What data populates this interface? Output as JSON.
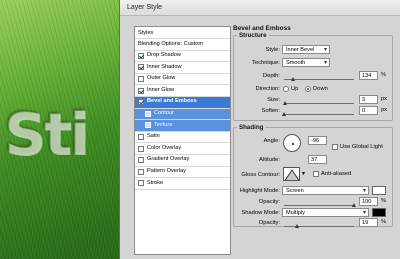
{
  "window": {
    "title": "Layer Style"
  },
  "sidebar": {
    "header": "Styles",
    "items": [
      {
        "label": "Blending Options: Custom",
        "checkbox": false,
        "checked": false
      },
      {
        "label": "Drop Shadow",
        "checkbox": true,
        "checked": true
      },
      {
        "label": "Inner Shadow",
        "checkbox": true,
        "checked": true
      },
      {
        "label": "Outer Glow",
        "checkbox": true,
        "checked": false
      },
      {
        "label": "Inner Glow",
        "checkbox": true,
        "checked": true
      },
      {
        "label": "Bevel and Emboss",
        "checkbox": true,
        "checked": true,
        "selected": true
      },
      {
        "label": "Contour",
        "checkbox": true,
        "checked": false,
        "sub": true
      },
      {
        "label": "Texture",
        "checkbox": true,
        "checked": false,
        "sub": true
      },
      {
        "label": "Satin",
        "checkbox": true,
        "checked": false
      },
      {
        "label": "Color Overlay",
        "checkbox": true,
        "checked": false
      },
      {
        "label": "Gradient Overlay",
        "checkbox": true,
        "checked": false
      },
      {
        "label": "Pattern Overlay",
        "checkbox": true,
        "checked": false
      },
      {
        "label": "Stroke",
        "checkbox": true,
        "checked": false
      }
    ]
  },
  "panel": {
    "title": "Bevel and Emboss",
    "structure": {
      "label": "Structure",
      "style_label": "Style:",
      "style_value": "Inner Bevel",
      "technique_label": "Technique:",
      "technique_value": "Smooth",
      "depth_label": "Depth:",
      "depth_value": "134",
      "depth_unit": "%",
      "depth_level": 0.134,
      "direction_label": "Direction:",
      "up_label": "Up",
      "down_label": "Down",
      "direction_value": "Down",
      "size_label": "Size:",
      "size_value": "3",
      "size_unit": "px",
      "size_level": 0.02,
      "soften_label": "Soften:",
      "soften_value": "0",
      "soften_unit": "px",
      "soften_level": 0
    },
    "shading": {
      "label": "Shading",
      "angle_label": "Angle:",
      "angle_value": "-96",
      "global_light_label": "Use Global Light",
      "global_light_checked": false,
      "altitude_label": "Altitude:",
      "altitude_value": "37",
      "gloss_label": "Gloss Contour:",
      "antialiased_label": "Anti-aliased",
      "antialiased_checked": false,
      "highlight_mode_label": "Highlight Mode:",
      "highlight_mode_value": "Screen",
      "highlight_color": "#ffffff",
      "highlight_opacity_label": "Opacity:",
      "highlight_opacity_value": "100",
      "highlight_opacity_unit": "%",
      "highlight_opacity_level": 1.0,
      "shadow_mode_label": "Shadow Mode:",
      "shadow_mode_value": "Multiply",
      "shadow_color": "#000000",
      "shadow_opacity_label": "Opacity:",
      "shadow_opacity_value": "19",
      "shadow_opacity_unit": "%",
      "shadow_opacity_level": 0.19
    }
  },
  "canvas": {
    "text": "Sti"
  },
  "colors": {
    "accent": "#3a7bd5",
    "sub_accent": "#5a92e0"
  }
}
